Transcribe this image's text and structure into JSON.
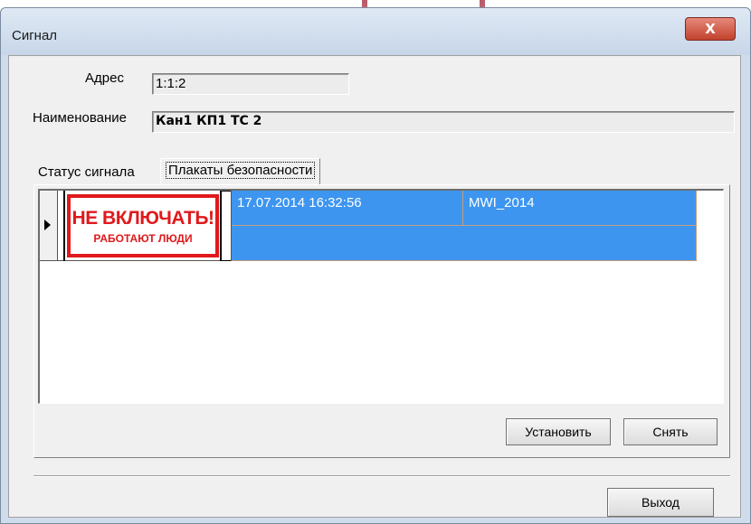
{
  "window": {
    "title": "Сигнал",
    "close_glyph": "X"
  },
  "form": {
    "address_label": "Адрес",
    "address_value": "1:1:2",
    "name_label": "Наименование",
    "name_value": "Кан1 КП1 ТС 2"
  },
  "tabs": [
    {
      "label": "Статус сигнала",
      "active": false
    },
    {
      "label": "Плакаты безопасности",
      "active": true
    }
  ],
  "grid": {
    "rows": [
      {
        "poster_title": "НЕ ВКЛЮЧАТЬ!",
        "poster_subtitle": "РАБОТАЮТ ЛЮДИ",
        "datetime": "17.07.2014 16:32:56",
        "user": "MWI_2014",
        "selected": true
      }
    ]
  },
  "buttons": {
    "install": "Установить",
    "remove": "Снять",
    "exit": "Выход"
  },
  "colors": {
    "selection": "#3d95f0",
    "poster_red": "#e0191c",
    "close_button": "#c2422d"
  }
}
